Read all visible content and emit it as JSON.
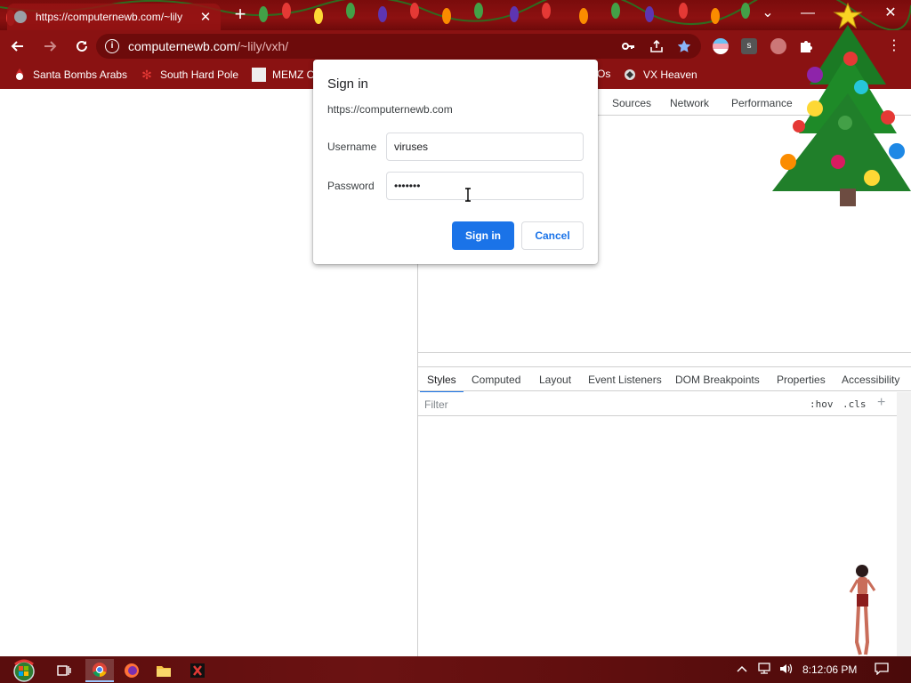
{
  "tab": {
    "title": "https://computernewb.com/~lily",
    "close": "✕"
  },
  "window": {
    "new_tab": "+",
    "dropdown": "⌄",
    "minimize": "—",
    "close": "✕"
  },
  "address_bar": {
    "host": "computernewb.com",
    "path": "/~lily/vxh/"
  },
  "bookmarks": [
    {
      "label": "Santa Bombs Arabs",
      "icon": "santa-icon"
    },
    {
      "label": "South Hard Pole",
      "icon": "snowflake-icon"
    },
    {
      "label": "MEMZ C",
      "icon": "memz-icon"
    },
    {
      "label": "Os",
      "icon": "folder-icon"
    },
    {
      "label": "VX Heaven",
      "icon": "vx-heaven-icon"
    }
  ],
  "devtools": {
    "top_tabs": [
      "Sources",
      "Network",
      "Performance"
    ],
    "sub_tabs": [
      "Styles",
      "Computed",
      "Layout",
      "Event Listeners",
      "DOM Breakpoints",
      "Properties",
      "Accessibility"
    ],
    "filter_placeholder": "Filter",
    "hov": ":hov",
    "cls": ".cls",
    "add": "+"
  },
  "dialog": {
    "title": "Sign in",
    "origin": "https://computernewb.com",
    "username_label": "Username",
    "username_value": "viruses",
    "password_label": "Password",
    "password_value": "•••••••",
    "sign_in_label": "Sign in",
    "cancel_label": "Cancel"
  },
  "taskbar": {
    "clock": "8:12:06 PM",
    "apps": [
      "start-orb",
      "task-view",
      "chrome",
      "firefox",
      "file-explorer",
      "x-app"
    ]
  },
  "colors": {
    "chrome_frame": "#8a1212",
    "accent": "#1a73e8",
    "taskbar": "#5a0d0d"
  }
}
